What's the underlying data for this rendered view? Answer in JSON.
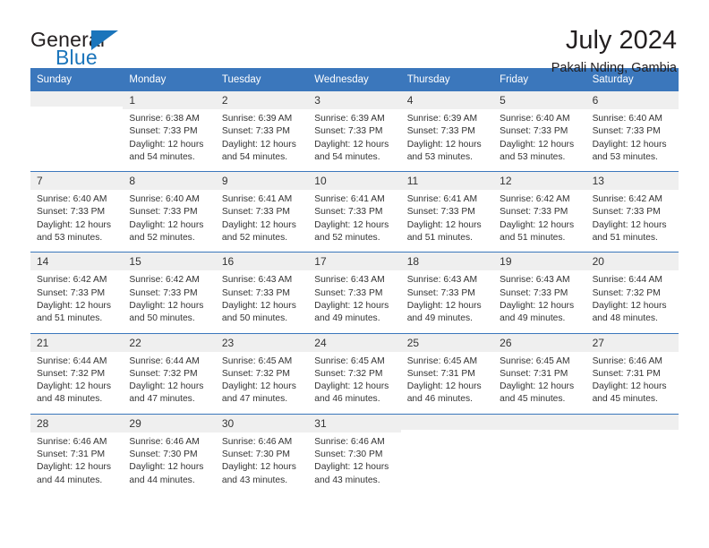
{
  "brand": {
    "name_top": "General",
    "name_bottom": "Blue",
    "accent_color": "#1b75bb"
  },
  "header": {
    "title": "July 2024",
    "subtitle": "Pakali Nding, Gambia",
    "header_bar_color": "#3b77bc",
    "day_band_color": "#efefef"
  },
  "weekdays": [
    "Sunday",
    "Monday",
    "Tuesday",
    "Wednesday",
    "Thursday",
    "Friday",
    "Saturday"
  ],
  "weeks": [
    [
      {
        "day": "",
        "sunrise": "",
        "sunset": "",
        "daylight_line1": "",
        "daylight_line2": ""
      },
      {
        "day": "1",
        "sunrise": "Sunrise: 6:38 AM",
        "sunset": "Sunset: 7:33 PM",
        "daylight_line1": "Daylight: 12 hours",
        "daylight_line2": "and 54 minutes."
      },
      {
        "day": "2",
        "sunrise": "Sunrise: 6:39 AM",
        "sunset": "Sunset: 7:33 PM",
        "daylight_line1": "Daylight: 12 hours",
        "daylight_line2": "and 54 minutes."
      },
      {
        "day": "3",
        "sunrise": "Sunrise: 6:39 AM",
        "sunset": "Sunset: 7:33 PM",
        "daylight_line1": "Daylight: 12 hours",
        "daylight_line2": "and 54 minutes."
      },
      {
        "day": "4",
        "sunrise": "Sunrise: 6:39 AM",
        "sunset": "Sunset: 7:33 PM",
        "daylight_line1": "Daylight: 12 hours",
        "daylight_line2": "and 53 minutes."
      },
      {
        "day": "5",
        "sunrise": "Sunrise: 6:40 AM",
        "sunset": "Sunset: 7:33 PM",
        "daylight_line1": "Daylight: 12 hours",
        "daylight_line2": "and 53 minutes."
      },
      {
        "day": "6",
        "sunrise": "Sunrise: 6:40 AM",
        "sunset": "Sunset: 7:33 PM",
        "daylight_line1": "Daylight: 12 hours",
        "daylight_line2": "and 53 minutes."
      }
    ],
    [
      {
        "day": "7",
        "sunrise": "Sunrise: 6:40 AM",
        "sunset": "Sunset: 7:33 PM",
        "daylight_line1": "Daylight: 12 hours",
        "daylight_line2": "and 53 minutes."
      },
      {
        "day": "8",
        "sunrise": "Sunrise: 6:40 AM",
        "sunset": "Sunset: 7:33 PM",
        "daylight_line1": "Daylight: 12 hours",
        "daylight_line2": "and 52 minutes."
      },
      {
        "day": "9",
        "sunrise": "Sunrise: 6:41 AM",
        "sunset": "Sunset: 7:33 PM",
        "daylight_line1": "Daylight: 12 hours",
        "daylight_line2": "and 52 minutes."
      },
      {
        "day": "10",
        "sunrise": "Sunrise: 6:41 AM",
        "sunset": "Sunset: 7:33 PM",
        "daylight_line1": "Daylight: 12 hours",
        "daylight_line2": "and 52 minutes."
      },
      {
        "day": "11",
        "sunrise": "Sunrise: 6:41 AM",
        "sunset": "Sunset: 7:33 PM",
        "daylight_line1": "Daylight: 12 hours",
        "daylight_line2": "and 51 minutes."
      },
      {
        "day": "12",
        "sunrise": "Sunrise: 6:42 AM",
        "sunset": "Sunset: 7:33 PM",
        "daylight_line1": "Daylight: 12 hours",
        "daylight_line2": "and 51 minutes."
      },
      {
        "day": "13",
        "sunrise": "Sunrise: 6:42 AM",
        "sunset": "Sunset: 7:33 PM",
        "daylight_line1": "Daylight: 12 hours",
        "daylight_line2": "and 51 minutes."
      }
    ],
    [
      {
        "day": "14",
        "sunrise": "Sunrise: 6:42 AM",
        "sunset": "Sunset: 7:33 PM",
        "daylight_line1": "Daylight: 12 hours",
        "daylight_line2": "and 51 minutes."
      },
      {
        "day": "15",
        "sunrise": "Sunrise: 6:42 AM",
        "sunset": "Sunset: 7:33 PM",
        "daylight_line1": "Daylight: 12 hours",
        "daylight_line2": "and 50 minutes."
      },
      {
        "day": "16",
        "sunrise": "Sunrise: 6:43 AM",
        "sunset": "Sunset: 7:33 PM",
        "daylight_line1": "Daylight: 12 hours",
        "daylight_line2": "and 50 minutes."
      },
      {
        "day": "17",
        "sunrise": "Sunrise: 6:43 AM",
        "sunset": "Sunset: 7:33 PM",
        "daylight_line1": "Daylight: 12 hours",
        "daylight_line2": "and 49 minutes."
      },
      {
        "day": "18",
        "sunrise": "Sunrise: 6:43 AM",
        "sunset": "Sunset: 7:33 PM",
        "daylight_line1": "Daylight: 12 hours",
        "daylight_line2": "and 49 minutes."
      },
      {
        "day": "19",
        "sunrise": "Sunrise: 6:43 AM",
        "sunset": "Sunset: 7:33 PM",
        "daylight_line1": "Daylight: 12 hours",
        "daylight_line2": "and 49 minutes."
      },
      {
        "day": "20",
        "sunrise": "Sunrise: 6:44 AM",
        "sunset": "Sunset: 7:32 PM",
        "daylight_line1": "Daylight: 12 hours",
        "daylight_line2": "and 48 minutes."
      }
    ],
    [
      {
        "day": "21",
        "sunrise": "Sunrise: 6:44 AM",
        "sunset": "Sunset: 7:32 PM",
        "daylight_line1": "Daylight: 12 hours",
        "daylight_line2": "and 48 minutes."
      },
      {
        "day": "22",
        "sunrise": "Sunrise: 6:44 AM",
        "sunset": "Sunset: 7:32 PM",
        "daylight_line1": "Daylight: 12 hours",
        "daylight_line2": "and 47 minutes."
      },
      {
        "day": "23",
        "sunrise": "Sunrise: 6:45 AM",
        "sunset": "Sunset: 7:32 PM",
        "daylight_line1": "Daylight: 12 hours",
        "daylight_line2": "and 47 minutes."
      },
      {
        "day": "24",
        "sunrise": "Sunrise: 6:45 AM",
        "sunset": "Sunset: 7:32 PM",
        "daylight_line1": "Daylight: 12 hours",
        "daylight_line2": "and 46 minutes."
      },
      {
        "day": "25",
        "sunrise": "Sunrise: 6:45 AM",
        "sunset": "Sunset: 7:31 PM",
        "daylight_line1": "Daylight: 12 hours",
        "daylight_line2": "and 46 minutes."
      },
      {
        "day": "26",
        "sunrise": "Sunrise: 6:45 AM",
        "sunset": "Sunset: 7:31 PM",
        "daylight_line1": "Daylight: 12 hours",
        "daylight_line2": "and 45 minutes."
      },
      {
        "day": "27",
        "sunrise": "Sunrise: 6:46 AM",
        "sunset": "Sunset: 7:31 PM",
        "daylight_line1": "Daylight: 12 hours",
        "daylight_line2": "and 45 minutes."
      }
    ],
    [
      {
        "day": "28",
        "sunrise": "Sunrise: 6:46 AM",
        "sunset": "Sunset: 7:31 PM",
        "daylight_line1": "Daylight: 12 hours",
        "daylight_line2": "and 44 minutes."
      },
      {
        "day": "29",
        "sunrise": "Sunrise: 6:46 AM",
        "sunset": "Sunset: 7:30 PM",
        "daylight_line1": "Daylight: 12 hours",
        "daylight_line2": "and 44 minutes."
      },
      {
        "day": "30",
        "sunrise": "Sunrise: 6:46 AM",
        "sunset": "Sunset: 7:30 PM",
        "daylight_line1": "Daylight: 12 hours",
        "daylight_line2": "and 43 minutes."
      },
      {
        "day": "31",
        "sunrise": "Sunrise: 6:46 AM",
        "sunset": "Sunset: 7:30 PM",
        "daylight_line1": "Daylight: 12 hours",
        "daylight_line2": "and 43 minutes."
      },
      {
        "day": "",
        "sunrise": "",
        "sunset": "",
        "daylight_line1": "",
        "daylight_line2": ""
      },
      {
        "day": "",
        "sunrise": "",
        "sunset": "",
        "daylight_line1": "",
        "daylight_line2": ""
      },
      {
        "day": "",
        "sunrise": "",
        "sunset": "",
        "daylight_line1": "",
        "daylight_line2": ""
      }
    ]
  ]
}
